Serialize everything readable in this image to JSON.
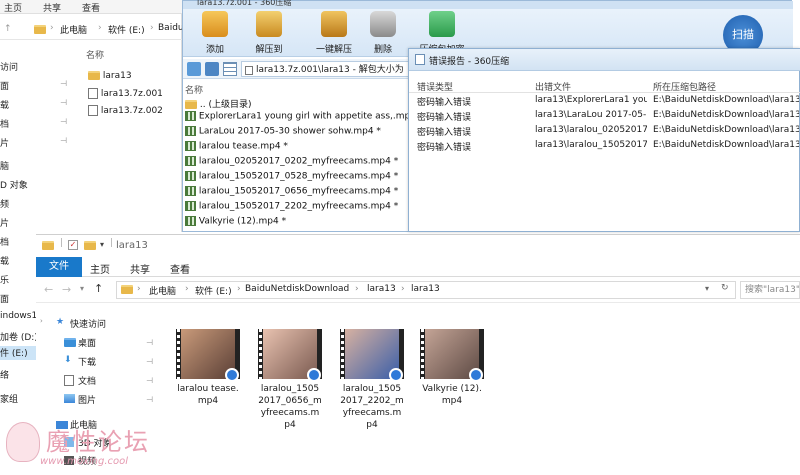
{
  "back_explorer": {
    "ribbon_tabs": [
      "主页",
      "共享",
      "查看"
    ],
    "address": [
      "此电脑",
      "软件 (E:)",
      "Baidu"
    ],
    "nav_items": [
      "访问",
      "面",
      "载",
      "档",
      "片",
      "脑",
      "D 对象",
      "频",
      "片",
      "档",
      "载",
      "乐",
      "面",
      "indows1",
      "加卷 (D:)",
      "件 (E:)",
      "络",
      "家组"
    ],
    "column_header": "名称",
    "files": [
      "lara13",
      "lara13.7z.001",
      "lara13.7z.002"
    ]
  },
  "zip_window": {
    "title": "lara13.7z.001 - 360压缩",
    "toolbar": [
      "添加",
      "解压到",
      "一键解压",
      "删除",
      "压缩包加密"
    ],
    "scan_label": "扫描",
    "path": "lara13.7z.001\\lara13 - 解包大小为",
    "column_header": "名称",
    "files": [
      ".. (上级目录)",
      "ExplorerLara1 young girl with appetite ass,.mp4 *",
      "LaraLou 2017-05-30 shower sohw.mp4 *",
      "laralou tease.mp4 *",
      "laralou_02052017_0202_myfreecams.mp4 *",
      "laralou_15052017_0528_myfreecams.mp4 *",
      "laralou_15052017_0656_myfreecams.mp4 *",
      "laralou_15052017_2202_myfreecams.mp4 *",
      "Valkyrie (12).mp4 *"
    ]
  },
  "error_report": {
    "title": "错误报告 - 360压缩",
    "headers": [
      "错误类型",
      "出错文件",
      "所在压缩包路径"
    ],
    "rows": [
      [
        "密码输入错误",
        "lara13\\ExplorerLara1 you...",
        "E:\\BaiduNetdiskDownload\\lara13\\l..."
      ],
      [
        "密码输入错误",
        "lara13\\LaraLou 2017-05-...",
        "E:\\BaiduNetdiskDownload\\lara13\\l..."
      ],
      [
        "密码输入错误",
        "lara13\\laralou_02052017_...",
        "E:\\BaiduNetdiskDownload\\lara13\\l..."
      ],
      [
        "密码输入错误",
        "lara13\\laralou_15052017_...",
        "E:\\BaiduNetdiskDownload\\lara13\\l..."
      ]
    ]
  },
  "front_explorer": {
    "title": "lara13",
    "ribbon_tabs": [
      "文件",
      "主页",
      "共享",
      "查看"
    ],
    "address": [
      "此电脑",
      "软件 (E:)",
      "BaiduNetdiskDownload",
      "lara13",
      "lara13"
    ],
    "search_placeholder": "搜索\"lara13\"",
    "nav_items": [
      "快速访问",
      "桌面",
      "下载",
      "文档",
      "图片",
      "此电脑",
      "3D 对象",
      "视频"
    ],
    "files": [
      "laralou tease.mp4",
      "laralou_15052017_0656_myfreecams.mp4",
      "laralou_15052017_2202_myfreecams.mp4",
      "Valkyrie (12).mp4"
    ]
  },
  "watermark": {
    "text": "魔性论坛",
    "url": "www.moxing.cool"
  },
  "colors": {
    "accent_blue": "#1979ca",
    "zip_toolbar": "#d6e6f6"
  }
}
